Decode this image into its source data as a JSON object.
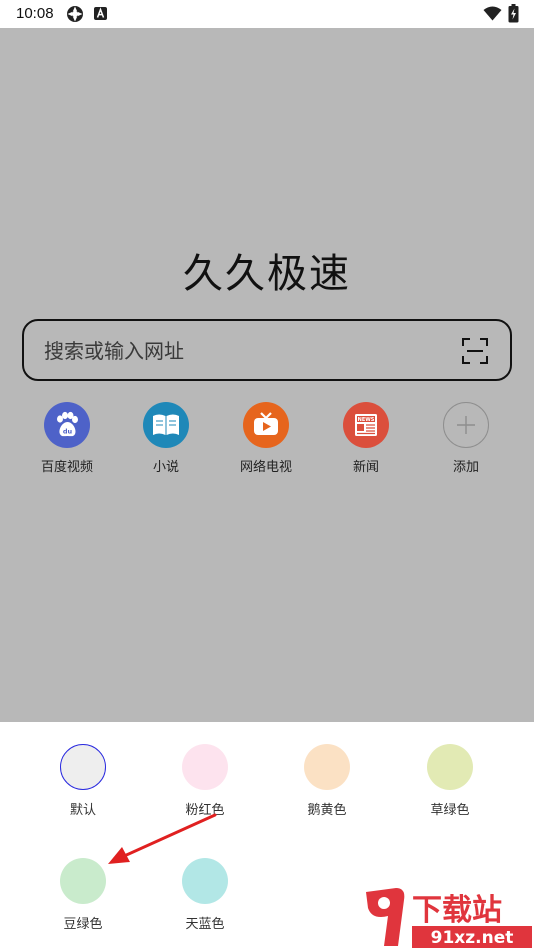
{
  "status_bar": {
    "time": "10:08",
    "icons": [
      "sync-icon",
      "a-badge-icon",
      "wifi-icon",
      "battery-charging-icon"
    ]
  },
  "main": {
    "background_color": "#b8b8b8",
    "logo_title": "久久极速",
    "search": {
      "placeholder": "搜索或输入网址"
    },
    "shortcuts": [
      {
        "label": "百度视频",
        "color": "#4e62c8",
        "icon": "baidu-paw-icon"
      },
      {
        "label": "小说",
        "color": "#1f88b8",
        "icon": "book-icon"
      },
      {
        "label": "网络电视",
        "color": "#e6651d",
        "icon": "tv-icon"
      },
      {
        "label": "新闻",
        "color": "#db4f3c",
        "icon": "news-icon"
      },
      {
        "label": "添加",
        "color": "#b8b8b8",
        "icon": "plus-icon"
      }
    ]
  },
  "color_panel": {
    "swatches": [
      {
        "label": "默认",
        "color": "#eeeeee",
        "selected": true
      },
      {
        "label": "粉红色",
        "color": "#fde3ee",
        "selected": false
      },
      {
        "label": "鹅黄色",
        "color": "#fbe1c4",
        "selected": false
      },
      {
        "label": "草绿色",
        "color": "#e2eab4",
        "selected": false
      },
      {
        "label": "豆绿色",
        "color": "#c9ebcc",
        "selected": false
      },
      {
        "label": "天蓝色",
        "color": "#b2e7e6",
        "selected": false
      }
    ]
  },
  "annotation": {
    "arrow_color": "#e02020"
  },
  "watermark": {
    "logo_text": "下载站",
    "domain": "91xz.net",
    "color": "#e0353d"
  }
}
